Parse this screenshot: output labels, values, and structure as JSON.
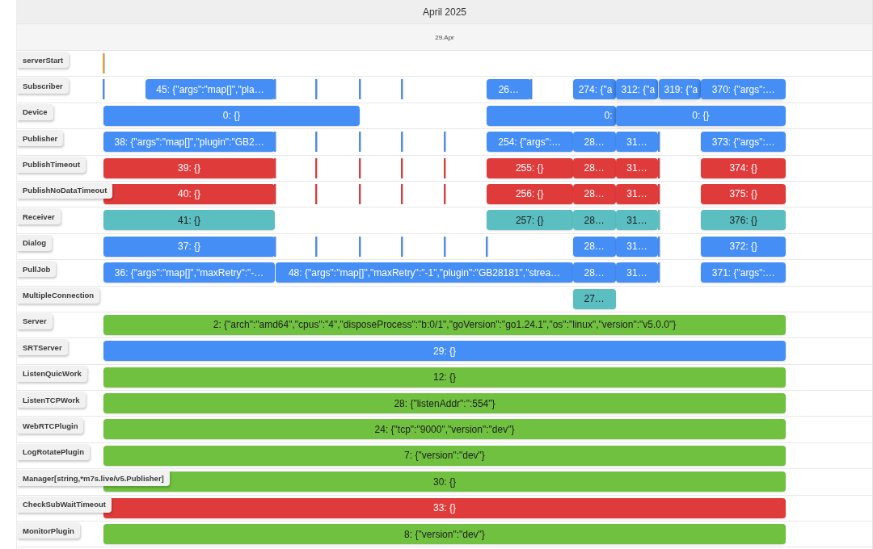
{
  "time_axis": {
    "major_label": "April 2025",
    "minor_label": "29.Apr"
  },
  "groups": [
    {
      "label": "serverStart",
      "items": [
        {
          "kind": "point",
          "color": "#e0a43a"
        }
      ]
    },
    {
      "label": "Subscriber",
      "items": [
        {
          "kind": "point",
          "color": "#448ef6"
        },
        {
          "kind": "range",
          "text": "45: {\"args\":\"map[]\",\"pla…",
          "color": "#448ef6"
        },
        {
          "kind": "point",
          "color": "#448ef6"
        },
        {
          "kind": "point",
          "color": "#448ef6"
        },
        {
          "kind": "point",
          "color": "#448ef6"
        },
        {
          "kind": "point",
          "color": "#448ef6"
        },
        {
          "kind": "range",
          "text": "26…",
          "color": "#448ef6"
        },
        {
          "kind": "point",
          "color": "#448ef6"
        },
        {
          "kind": "range",
          "text": "274: {\"a",
          "color": "#448ef6"
        },
        {
          "kind": "range",
          "text": "312: {\"a",
          "color": "#448ef6"
        },
        {
          "kind": "range",
          "text": "319: {\"a",
          "color": "#448ef6"
        },
        {
          "kind": "range",
          "text": "370: {\"args\":…",
          "color": "#448ef6"
        }
      ]
    },
    {
      "label": "Device",
      "items": [
        {
          "kind": "range",
          "text": "0: {}",
          "color": "#448ef6"
        },
        {
          "kind": "range",
          "text": "0:",
          "color": "#448ef6"
        },
        {
          "kind": "range",
          "text": "0: {}",
          "color": "#448ef6"
        }
      ]
    },
    {
      "label": "Publisher",
      "items": [
        {
          "kind": "range",
          "text": "38: {\"args\":\"map[]\",\"plugin\":\"GB2…",
          "color": "#448ef6"
        },
        {
          "kind": "point",
          "color": "#448ef6"
        },
        {
          "kind": "point",
          "color": "#448ef6"
        },
        {
          "kind": "point",
          "color": "#448ef6"
        },
        {
          "kind": "point",
          "color": "#448ef6"
        },
        {
          "kind": "point",
          "color": "#448ef6"
        },
        {
          "kind": "range",
          "text": "254: {\"args\":…",
          "color": "#448ef6"
        },
        {
          "kind": "range",
          "text": "28…",
          "color": "#448ef6"
        },
        {
          "kind": "range",
          "text": "31…",
          "color": "#448ef6"
        },
        {
          "kind": "point",
          "color": "#448ef6"
        },
        {
          "kind": "range",
          "text": "373: {\"args\":…",
          "color": "#448ef6"
        }
      ]
    },
    {
      "label": "PublishTimeout",
      "items": [
        {
          "kind": "range",
          "text": "39: {}",
          "color": "#e03b3b"
        },
        {
          "kind": "point",
          "color": "#e03b3b"
        },
        {
          "kind": "point",
          "color": "#e03b3b"
        },
        {
          "kind": "point",
          "color": "#e03b3b"
        },
        {
          "kind": "point",
          "color": "#e03b3b"
        },
        {
          "kind": "point",
          "color": "#e03b3b"
        },
        {
          "kind": "range",
          "text": "255: {}",
          "color": "#e03b3b"
        },
        {
          "kind": "range",
          "text": "28…",
          "color": "#e03b3b"
        },
        {
          "kind": "range",
          "text": "31…",
          "color": "#e03b3b"
        },
        {
          "kind": "point",
          "color": "#e03b3b"
        },
        {
          "kind": "range",
          "text": "374: {}",
          "color": "#e03b3b"
        }
      ]
    },
    {
      "label": "PublishNoDataTimeout",
      "items": [
        {
          "kind": "range",
          "text": "40: {}",
          "color": "#e03b3b"
        },
        {
          "kind": "point",
          "color": "#e03b3b"
        },
        {
          "kind": "point",
          "color": "#e03b3b"
        },
        {
          "kind": "point",
          "color": "#e03b3b"
        },
        {
          "kind": "point",
          "color": "#e03b3b"
        },
        {
          "kind": "point",
          "color": "#e03b3b"
        },
        {
          "kind": "range",
          "text": "256: {}",
          "color": "#e03b3b"
        },
        {
          "kind": "range",
          "text": "28…",
          "color": "#e03b3b"
        },
        {
          "kind": "range",
          "text": "31…",
          "color": "#e03b3b"
        },
        {
          "kind": "point",
          "color": "#e03b3b"
        },
        {
          "kind": "range",
          "text": "375: {}",
          "color": "#e03b3b"
        }
      ]
    },
    {
      "label": "Receiver",
      "items": [
        {
          "kind": "range",
          "text": "41: {}",
          "color": "#5bbfc1"
        },
        {
          "kind": "range",
          "text": "257: {}",
          "color": "#5bbfc1"
        },
        {
          "kind": "range",
          "text": "28…",
          "color": "#5bbfc1"
        },
        {
          "kind": "range",
          "text": "31…",
          "color": "#5bbfc1"
        },
        {
          "kind": "point",
          "color": "#5bbfc1"
        },
        {
          "kind": "range",
          "text": "376: {}",
          "color": "#5bbfc1"
        }
      ]
    },
    {
      "label": "Dialog",
      "items": [
        {
          "kind": "range",
          "text": "37: {}",
          "color": "#448ef6"
        },
        {
          "kind": "point",
          "color": "#448ef6"
        },
        {
          "kind": "point",
          "color": "#448ef6"
        },
        {
          "kind": "point",
          "color": "#448ef6"
        },
        {
          "kind": "point",
          "color": "#448ef6"
        },
        {
          "kind": "point",
          "color": "#448ef6"
        },
        {
          "kind": "point",
          "color": "#448ef6"
        },
        {
          "kind": "range",
          "text": "28…",
          "color": "#448ef6"
        },
        {
          "kind": "range",
          "text": "31…",
          "color": "#448ef6"
        },
        {
          "kind": "point",
          "color": "#448ef6"
        },
        {
          "kind": "range",
          "text": "372: {}",
          "color": "#448ef6"
        }
      ]
    },
    {
      "label": "PullJob",
      "items": [
        {
          "kind": "range",
          "text": "36: {\"args\":\"map[]\",\"maxRetry\":\"-…",
          "color": "#448ef6"
        },
        {
          "kind": "range",
          "text": "48: {\"args\":\"map[]\",\"maxRetry\":\"-1\",\"plugin\":\"GB28181\",\"strea…",
          "color": "#448ef6"
        },
        {
          "kind": "range",
          "text": "28…",
          "color": "#448ef6"
        },
        {
          "kind": "range",
          "text": "31…",
          "color": "#448ef6"
        },
        {
          "kind": "point",
          "color": "#448ef6"
        },
        {
          "kind": "range",
          "text": "371: {\"args\":…",
          "color": "#448ef6"
        }
      ]
    },
    {
      "label": "MultipleConnection",
      "items": [
        {
          "kind": "range",
          "text": "27…",
          "color": "#5bbfc1"
        }
      ]
    },
    {
      "label": "Server",
      "items": [
        {
          "kind": "range",
          "text": "2: {\"arch\":\"amd64\",\"cpus\":\"4\",\"disposeProcess\":\"b:0/1\",\"goVersion\":\"go1.24.1\",\"os\":\"linux\",\"version\":\"v5.0.0\"}",
          "color": "#70c140"
        }
      ]
    },
    {
      "label": "SRTServer",
      "items": [
        {
          "kind": "range",
          "text": "29: {}",
          "color": "#448ef6"
        }
      ]
    },
    {
      "label": "ListenQuicWork",
      "items": [
        {
          "kind": "range",
          "text": "12: {}",
          "color": "#70c140"
        }
      ]
    },
    {
      "label": "ListenTCPWork",
      "items": [
        {
          "kind": "range",
          "text": "28: {\"listenAddr\":\":554\"}",
          "color": "#70c140"
        }
      ]
    },
    {
      "label": "WebRTCPlugin",
      "items": [
        {
          "kind": "range",
          "text": "24: {\"tcp\":\"9000\",\"version\":\"dev\"}",
          "color": "#70c140"
        }
      ]
    },
    {
      "label": "LogRotatePlugin",
      "items": [
        {
          "kind": "range",
          "text": "7: {\"version\":\"dev\"}",
          "color": "#70c140"
        }
      ]
    },
    {
      "label": "Manager[string,*m7s.live/v5.Publisher]",
      "items": [
        {
          "kind": "range",
          "text": "30: {}",
          "color": "#70c140"
        }
      ]
    },
    {
      "label": "CheckSubWaitTimeout",
      "items": [
        {
          "kind": "range",
          "text": "33: {}",
          "color": "#e03b3b"
        }
      ]
    },
    {
      "label": "MonitorPlugin",
      "items": [
        {
          "kind": "range",
          "text": "8: {\"version\":\"dev\"}",
          "color": "#70c140"
        }
      ]
    }
  ]
}
